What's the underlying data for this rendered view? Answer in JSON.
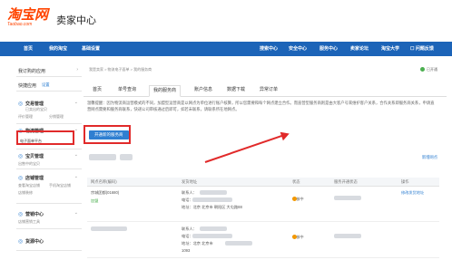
{
  "header": {
    "logo": "淘宝网",
    "logo_sub": "Taobao.com",
    "title": "卖家中心"
  },
  "topnav": {
    "left": [
      "首页",
      "我的淘宝",
      "基础设置"
    ],
    "right": [
      "搜索中心",
      "安全中心",
      "服务中心",
      "卖家论坛",
      "淘宝大学",
      "问题反馈"
    ]
  },
  "sidebar": {
    "quick": "我订购的应用",
    "shortcut": "快捷应用",
    "shortcut_action": "设置",
    "sections": [
      {
        "title": "交易管理",
        "subs": [
          "已卖出的宝贝",
          "评价管理",
          "分销管理"
        ]
      },
      {
        "title": "物流管理",
        "subs": [
          "电子面单平台"
        ]
      },
      {
        "title": "宝贝管理",
        "subs": [
          "出售中的宝贝"
        ]
      },
      {
        "title": "店铺管理",
        "subs": [
          "查看淘宝店铺",
          "手机淘宝店铺",
          "店铺装修"
        ]
      },
      {
        "title": "营销中心",
        "subs": [
          "店铺营销工具"
        ]
      },
      {
        "title": "货源中心",
        "subs": []
      }
    ]
  },
  "main": {
    "breadcrumb": "我是卖家 > 物流电子面单 > 我的服务商",
    "open_status": "已开通",
    "tabs": [
      "首页",
      "单号查询",
      "我的服务商",
      "账户信息",
      "数据下载",
      "异常订单"
    ],
    "active_tab": "我的服务商",
    "notice": "温馨提醒：因为物流商运营模式的不同，加盟型运营商是以网点为单位进行账户核算，所以您需要和每个网点建立合作。而直营型服务商则是由大客户号来维护客户关系，合作关系即服务商关系，申请直营网点需要和服务商联系，快递公司审核通过后即可，如若未联系，请联系所在地网点。",
    "apply_button": "开通新的服务商",
    "new_site_link": "新增网点",
    "table": {
      "headers": [
        "网点名称(编码)",
        "发货地址",
        "状态",
        "服务开通状态",
        "操作"
      ],
      "rows": [
        {
          "name": "宗城团都(01680)",
          "tag": "加盟",
          "contact": "联系人：",
          "phone": "电话：",
          "address": "地址：北京 北京市 朝阳区 大屯路88",
          "status": "审核中",
          "action": "修改发货地址"
        },
        {
          "name": "",
          "tag": "",
          "contact": "联系人：",
          "phone": "电话：",
          "address": "地址：北京 北京市",
          "extra": "1093",
          "status": "审核中",
          "action": ""
        }
      ]
    }
  },
  "colors": {
    "brand": "#ff4400",
    "nav": "#1c64b8",
    "button": "#2f7fd1",
    "highlight": "#e12a2a",
    "pending": "#f39800"
  }
}
